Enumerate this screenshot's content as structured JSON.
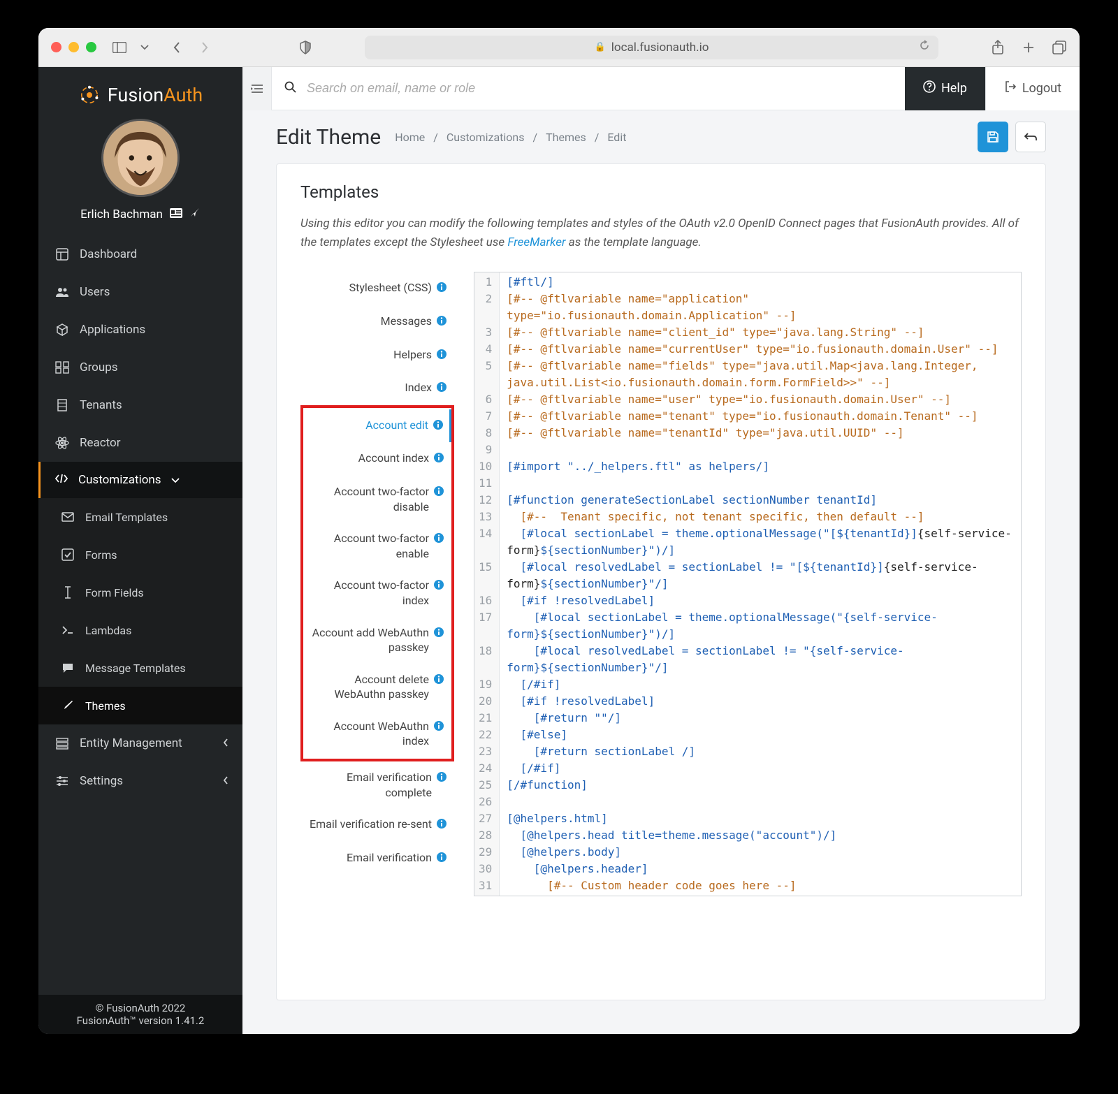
{
  "browser": {
    "url": "local.fusionauth.io"
  },
  "sidebar": {
    "brand_a": "Fusion",
    "brand_b": "Auth",
    "username": "Erlich Bachman",
    "items": [
      {
        "label": "Dashboard"
      },
      {
        "label": "Users"
      },
      {
        "label": "Applications"
      },
      {
        "label": "Groups"
      },
      {
        "label": "Tenants"
      },
      {
        "label": "Reactor"
      }
    ],
    "customizations_label": "Customizations",
    "sub_items": [
      {
        "label": "Email Templates"
      },
      {
        "label": "Forms"
      },
      {
        "label": "Form Fields"
      },
      {
        "label": "Lambdas"
      },
      {
        "label": "Message Templates"
      },
      {
        "label": "Themes"
      }
    ],
    "entity_mgmt": "Entity Management",
    "settings": "Settings",
    "footer1": "© FusionAuth 2022",
    "footer2": "FusionAuth™ version 1.41.2"
  },
  "topbar": {
    "search_placeholder": "Search on email, name or role",
    "help": "Help",
    "logout": "Logout"
  },
  "page": {
    "title": "Edit Theme",
    "breadcrumb": [
      "Home",
      "Customizations",
      "Themes",
      "Edit"
    ]
  },
  "content": {
    "heading": "Templates",
    "intro_a": "Using this editor you can modify the following templates and styles of the OAuth v2.0 OpenID Connect pages that FusionAuth provides. All of the templates except the Stylesheet use ",
    "intro_link": "FreeMarker",
    "intro_b": " as the template language."
  },
  "templates": {
    "top": [
      "Stylesheet (CSS)",
      "Messages",
      "Helpers",
      "Index"
    ],
    "highlighted": [
      "Account edit",
      "Account index",
      "Account two-factor disable",
      "Account two-factor enable",
      "Account two-factor index",
      "Account add WebAuthn passkey",
      "Account delete WebAuthn passkey",
      "Account WebAuthn index"
    ],
    "bottom": [
      "Email verification complete",
      "Email verification re-sent",
      "Email verification"
    ]
  },
  "code": {
    "lines": [
      {
        "n": 1,
        "h": "<span class=\"t-dir\">[#ftl/]</span>"
      },
      {
        "n": 2,
        "h": "<span class=\"t-comment\">[#-- @ftlvariable name=\"application\" type=\"io.fusionauth.domain.Application\" --]</span>"
      },
      {
        "n": 3,
        "h": "<span class=\"t-comment\">[#-- @ftlvariable name=\"client_id\" type=\"java.lang.String\" --]</span>"
      },
      {
        "n": 4,
        "h": "<span class=\"t-comment\">[#-- @ftlvariable name=\"currentUser\" type=\"io.fusionauth.domain.User\" --]</span>"
      },
      {
        "n": 5,
        "h": "<span class=\"t-comment\">[#-- @ftlvariable name=\"fields\" type=\"java.util.Map&lt;java.lang.Integer, java.util.List&lt;io.fusionauth.domain.form.FormField&gt;&gt;\" --]</span>"
      },
      {
        "n": 6,
        "h": "<span class=\"t-comment\">[#-- @ftlvariable name=\"user\" type=\"io.fusionauth.domain.User\" --]</span>"
      },
      {
        "n": 7,
        "h": "<span class=\"t-comment\">[#-- @ftlvariable name=\"tenant\" type=\"io.fusionauth.domain.Tenant\" --]</span>"
      },
      {
        "n": 8,
        "h": "<span class=\"t-comment\">[#-- @ftlvariable name=\"tenantId\" type=\"java.util.UUID\" --]</span>"
      },
      {
        "n": 9,
        "h": ""
      },
      {
        "n": 10,
        "h": "<span class=\"t-dir\">[#import \"../_helpers.ftl\" as helpers/]</span>"
      },
      {
        "n": 11,
        "h": ""
      },
      {
        "n": 12,
        "h": "<span class=\"t-dir\">[#function generateSectionLabel sectionNumber tenantId]</span>"
      },
      {
        "n": 13,
        "h": "  <span class=\"t-comment\">[#--  Tenant specific, not tenant specific, then default --]</span>"
      },
      {
        "n": 14,
        "h": "  <span class=\"t-dir\">[#local sectionLabel = theme.optionalMessage(\"[</span><span class=\"t-interp\">${tenantId}</span><span class=\"t-dir\">]</span><span class=\"t-plain\">{self-service-form}</span><span class=\"t-interp\">${sectionNumber}</span><span class=\"t-dir\">\")/]</span>"
      },
      {
        "n": 15,
        "h": "  <span class=\"t-dir\">[#local resolvedLabel = sectionLabel != \"[</span><span class=\"t-interp\">${tenantId}</span><span class=\"t-dir\">]</span><span class=\"t-plain\">{self-service-form}</span><span class=\"t-interp\">${sectionNumber}</span><span class=\"t-dir\">\"/]</span>"
      },
      {
        "n": 16,
        "h": "  <span class=\"t-dir\">[#if !resolvedLabel]</span>"
      },
      {
        "n": 17,
        "h": "    <span class=\"t-dir\">[#local sectionLabel = theme.optionalMessage(\"{self-service-form}</span><span class=\"t-interp\">${sectionNumber}</span><span class=\"t-dir\">\")/]</span>"
      },
      {
        "n": 18,
        "h": "    <span class=\"t-dir\">[#local resolvedLabel = sectionLabel != \"{self-service-form}</span><span class=\"t-interp\">${sectionNumber}</span><span class=\"t-dir\">\"/]</span>"
      },
      {
        "n": 19,
        "h": "  <span class=\"t-dir\">[/#if]</span>"
      },
      {
        "n": 20,
        "h": "  <span class=\"t-dir\">[#if !resolvedLabel]</span>"
      },
      {
        "n": 21,
        "h": "    <span class=\"t-dir\">[#return \"\"/]</span>"
      },
      {
        "n": 22,
        "h": "  <span class=\"t-dir\">[#else]</span>"
      },
      {
        "n": 23,
        "h": "    <span class=\"t-dir\">[#return sectionLabel /]</span>"
      },
      {
        "n": 24,
        "h": "  <span class=\"t-dir\">[/#if]</span>"
      },
      {
        "n": 25,
        "h": "<span class=\"t-dir\">[/#function]</span>"
      },
      {
        "n": 26,
        "h": ""
      },
      {
        "n": 27,
        "h": "<span class=\"t-dir\">[@helpers.html]</span>"
      },
      {
        "n": 28,
        "h": "  <span class=\"t-dir\">[@helpers.head title=theme.message(\"account\")/]</span>"
      },
      {
        "n": 29,
        "h": "  <span class=\"t-dir\">[@helpers.body]</span>"
      },
      {
        "n": 30,
        "h": "    <span class=\"t-dir\">[@helpers.header]</span>"
      },
      {
        "n": 31,
        "h": "      <span class=\"t-comment\">[#-- Custom header code goes here --]</span>"
      }
    ]
  }
}
